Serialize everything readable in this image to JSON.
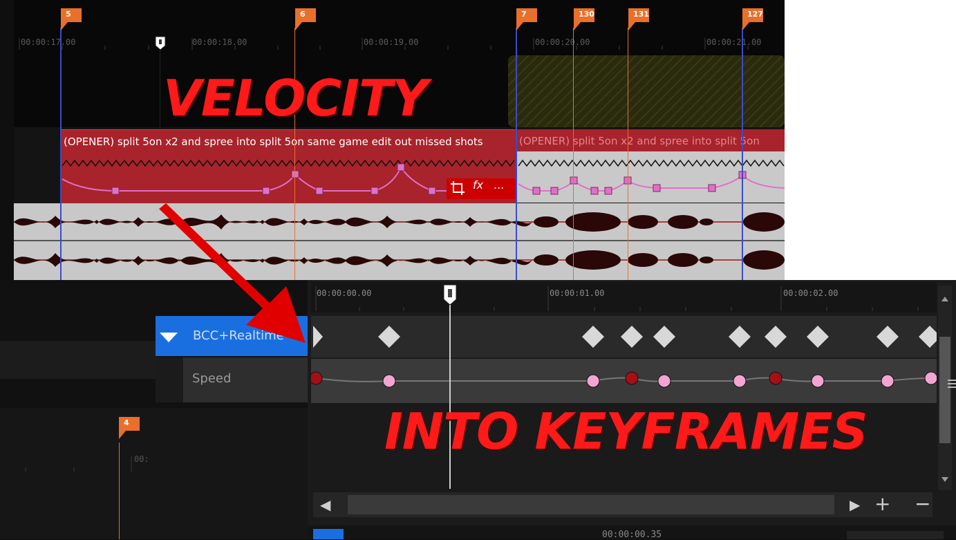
{
  "top_timeline": {
    "ruler": [
      "00:00:17.00",
      "00:00:18.00",
      "00:00:19.00",
      "00:00:20.00",
      "00:00:21.00"
    ],
    "markers": [
      "5",
      "6",
      "7",
      "130",
      "131",
      "127"
    ],
    "clip_left_title": "(OPENER) split 5on x2 and  spree into split 5on same game edit out missed shots",
    "clip_right_title": "(OPENER) split 5on x2 and  spree into split 5on",
    "clip_icons": {
      "crop": "crop-icon",
      "fx": "fx",
      "more": "..."
    }
  },
  "left_lower": {
    "marker": "4",
    "ruler_partial": "00:"
  },
  "keyframe_panel": {
    "ruler": [
      "00:00:00.00",
      "00:00:01.00",
      "00:00:02.00"
    ],
    "track_name": "BCC+Realtime",
    "param_name": "Speed",
    "timecode": "00:00:00.35",
    "buttons": {
      "add": "+",
      "remove": "−",
      "prev": "◀",
      "next": "▶"
    }
  },
  "overlay": {
    "top_text": "VELOCITY",
    "bottom_text": "INTO KEYFRAMES"
  },
  "colors": {
    "clip_red": "#a8232b",
    "marker_orange": "#e8702a",
    "keyframe_pink": "#f2a4d2",
    "keyframe_dark": "#a50f16",
    "overlay_red": "#ff1a1a",
    "track_blue": "#1a6fe0"
  }
}
